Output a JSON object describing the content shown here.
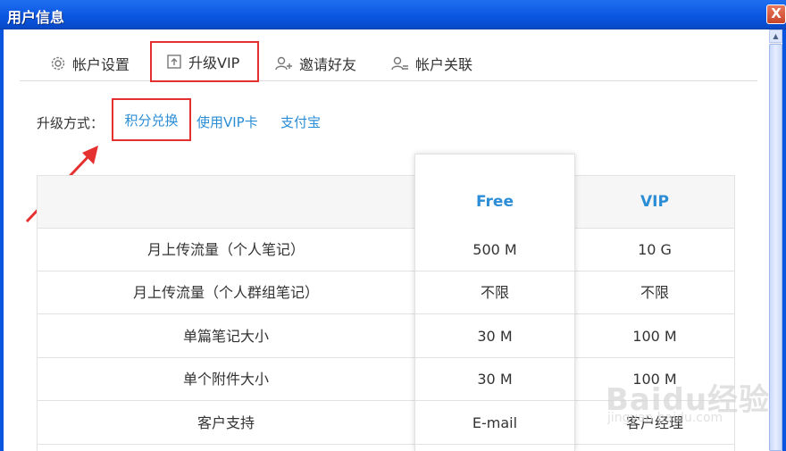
{
  "window": {
    "title": "用户信息",
    "close_label": "X"
  },
  "tabs": [
    {
      "label": "帐户设置",
      "icon": "gear-icon"
    },
    {
      "label": "升级VIP",
      "icon": "upload-icon"
    },
    {
      "label": "邀请好友",
      "icon": "add-user-icon"
    },
    {
      "label": "帐户关联",
      "icon": "link-user-icon"
    }
  ],
  "upgrade": {
    "label": "升级方式：",
    "methods": [
      "积分兑换",
      "使用VIP卡",
      "支付宝"
    ]
  },
  "table": {
    "columns": [
      "",
      "Free",
      "VIP"
    ],
    "rows": [
      {
        "feature": "月上传流量（个人笔记）",
        "free": "500 M",
        "vip": "10 G"
      },
      {
        "feature": "月上传流量（个人群组笔记）",
        "free": "不限",
        "vip": "不限"
      },
      {
        "feature": "单篇笔记大小",
        "free": "30 M",
        "vip": "100 M"
      },
      {
        "feature": "单个附件大小",
        "free": "30 M",
        "vip": "100 M"
      },
      {
        "feature": "客户支持",
        "free": "E-mail",
        "vip": "客户经理"
      }
    ]
  },
  "watermark": {
    "text": "Baidu经验",
    "url": "jingyan.baidu.com"
  },
  "colors": {
    "accent": "#2b8dd6",
    "highlight": "#e53030",
    "titlebar": "#0a55e0"
  }
}
